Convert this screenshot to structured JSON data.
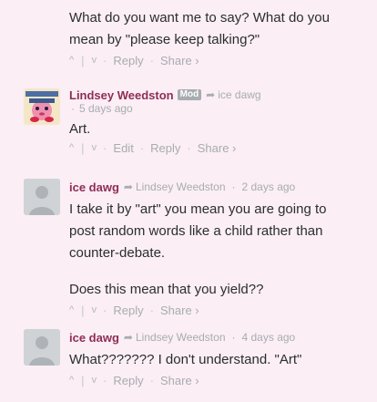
{
  "comments": [
    {
      "text": "What do you want me to say? What do you mean by \"please keep talking?\"",
      "actions": {
        "reply": "Reply",
        "share": "Share ›"
      }
    },
    {
      "author": "Lindsey Weedston",
      "badge": "Mod",
      "reply_to": "ice dawg",
      "time": "5 days ago",
      "text": "Art.",
      "actions": {
        "edit": "Edit",
        "reply": "Reply",
        "share": "Share ›"
      }
    },
    {
      "author": "ice dawg",
      "reply_to": "Lindsey Weedston",
      "time": "2 days ago",
      "paragraph1": "I take it by \"art\" you mean you are going to post random words like a child rather than counter-debate.",
      "paragraph2": "Does this mean that you yield??",
      "actions": {
        "reply": "Reply",
        "share": "Share ›"
      }
    },
    {
      "author": "ice dawg",
      "reply_to": "Lindsey Weedston",
      "time": "4 days ago",
      "text": "What??????? I don't understand. \"Art\"",
      "actions": {
        "reply": "Reply",
        "share": "Share ›"
      }
    }
  ],
  "icons": {
    "upvote": "^",
    "downvote": "v",
    "reply_arrow": "➦",
    "dot": "·",
    "pipe": "|"
  },
  "colors": {
    "background": "#fbeef5",
    "author": "#8f2d56",
    "meta": "#a7acb0"
  }
}
